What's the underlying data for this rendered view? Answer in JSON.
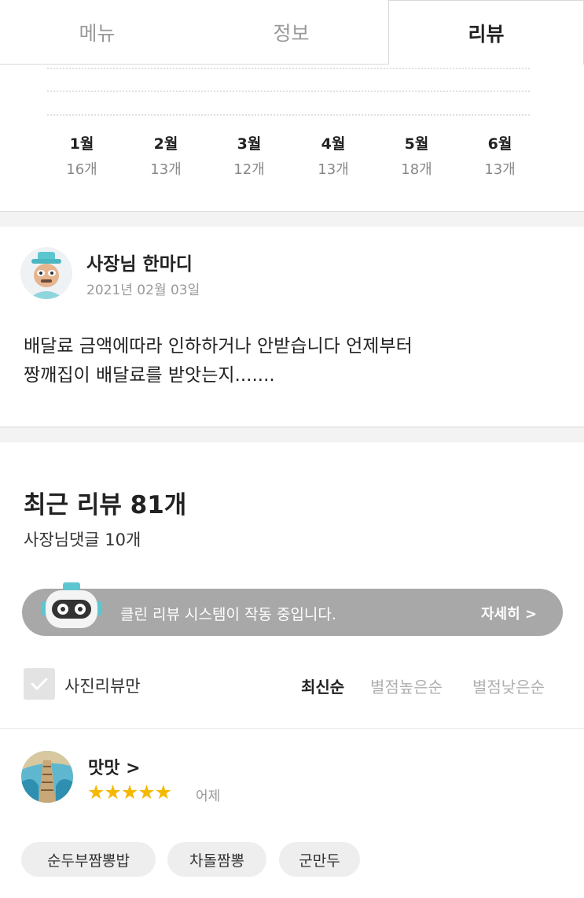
{
  "tabs": [
    {
      "label": "메뉴",
      "active": false
    },
    {
      "label": "정보",
      "active": false
    },
    {
      "label": "리뷰",
      "active": true
    }
  ],
  "monthly": [
    {
      "month": "1월",
      "count": "16개"
    },
    {
      "month": "2월",
      "count": "13개"
    },
    {
      "month": "3월",
      "count": "12개"
    },
    {
      "month": "4월",
      "count": "13개"
    },
    {
      "month": "5월",
      "count": "18개"
    },
    {
      "month": "6월",
      "count": "13개"
    }
  ],
  "owner_comment": {
    "title": "사장님 한마디",
    "date": "2021년 02월 03일",
    "line1": "배달료 금액에따라 인하하거나 안받습니다 언제부터",
    "line2": "짱깨집이 배달료를 받앗는지......."
  },
  "reviews_header": {
    "title": "최근 리뷰 81개",
    "owner_replies": "사장님댓글 10개"
  },
  "clean_review": {
    "text": "클린 리뷰 시스템이 작동 중입니다.",
    "more": "자세히 >"
  },
  "filter": {
    "photo_only": "사진리뷰만"
  },
  "sort_options": [
    "최신순",
    "별점높은순",
    "별점낮은순"
  ],
  "review": {
    "name": "맛맛 >",
    "stars": "★★★★★",
    "rating": 5,
    "date": "어제",
    "menu_tags": [
      "순두부짬뽕밥",
      "차돌짬뽕",
      "군만두"
    ]
  },
  "colors": {
    "star": "#f5b800",
    "clean_bar": "#a8a8a8",
    "robot_accent": "#5cc6d0"
  }
}
